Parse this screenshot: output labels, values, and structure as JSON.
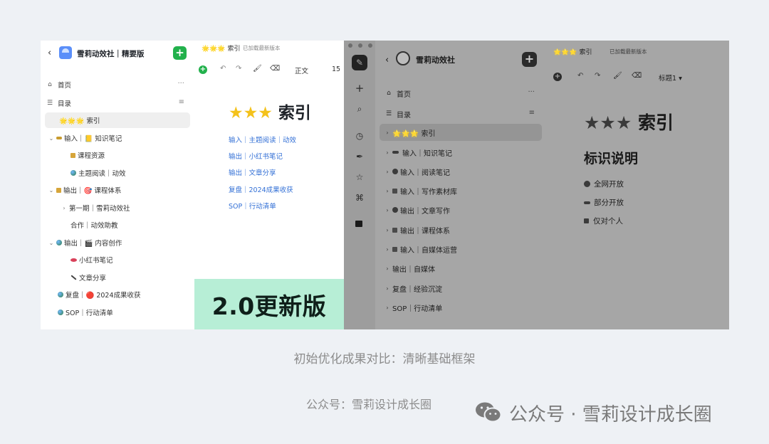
{
  "left_app": {
    "sidebar": {
      "back": "‹",
      "title": "雪莉动效社｜精要版",
      "add_label": "+",
      "items": [
        {
          "icon": "home-icon",
          "label": "首页"
        },
        {
          "icon": "toc-icon",
          "label": "目录"
        },
        {
          "label": "🌟🌟🌟 索引",
          "active": true
        },
        {
          "label": "输入｜📒 知识笔记",
          "icon": "key-icon"
        },
        {
          "label": "课程资源",
          "icon": "lock-icon"
        },
        {
          "label": "主题阅读｜动效",
          "icon": "globe-icon"
        },
        {
          "label": "输出｜🎯 课程体系",
          "icon": "lock-icon"
        },
        {
          "label": "第一期｜雪莉动效社"
        },
        {
          "label": "合作｜动效助教"
        },
        {
          "label": "输出｜🎬 内容创作",
          "icon": "globe-icon"
        },
        {
          "label": "小红书笔记",
          "icon": "lips-icon"
        },
        {
          "label": "文章分享",
          "icon": "pencil-icon"
        },
        {
          "label": "复盘｜🔴 2024成果收获",
          "icon": "globe-icon"
        },
        {
          "label": "SOP｜行动清单",
          "icon": "globe-icon"
        }
      ]
    },
    "editor": {
      "tab_title": "🌟🌟🌟 索引",
      "status": "已加载最新版本",
      "toolbar_style": "正文",
      "toolbar_size": "15",
      "heading": "索引",
      "links": [
        "输入｜主题阅读｜动效",
        "输出｜小红书笔记",
        "输出｜文章分享",
        "复盘｜2024成果收获",
        "SOP｜行动清单"
      ]
    },
    "banner": "2.0更新版"
  },
  "right_app": {
    "sidebar": {
      "back": "‹",
      "title": "雪莉动效社",
      "add_label": "+",
      "items": [
        {
          "label": "首页"
        },
        {
          "label": "目录"
        },
        {
          "label": "🌟🌟🌟 索引",
          "active": true
        },
        {
          "label": "输入｜知识笔记"
        },
        {
          "label": "输入｜阅读笔记"
        },
        {
          "label": "输入｜写作素材库"
        },
        {
          "label": "输出｜文章写作"
        },
        {
          "label": "输出｜课程体系"
        },
        {
          "label": "输入｜自媒体运营"
        },
        {
          "label": "输出｜自媒体"
        },
        {
          "label": "复盘｜经验沉淀"
        },
        {
          "label": "SOP｜行动清单"
        }
      ]
    },
    "editor": {
      "tab_title": "🌟🌟🌟 索引",
      "status": "已加载最新版本",
      "toolbar_style": "标题1",
      "heading": "索引",
      "subheading": "标识说明",
      "legend": [
        "全网开放",
        "部分开放",
        "仅对个人"
      ]
    }
  },
  "captions": {
    "main": "初始优化成果对比：清晰基础框架",
    "sub": "公众号：雪莉设计成长圈",
    "watermark": "公众号 · 雪莉设计成长圈"
  }
}
